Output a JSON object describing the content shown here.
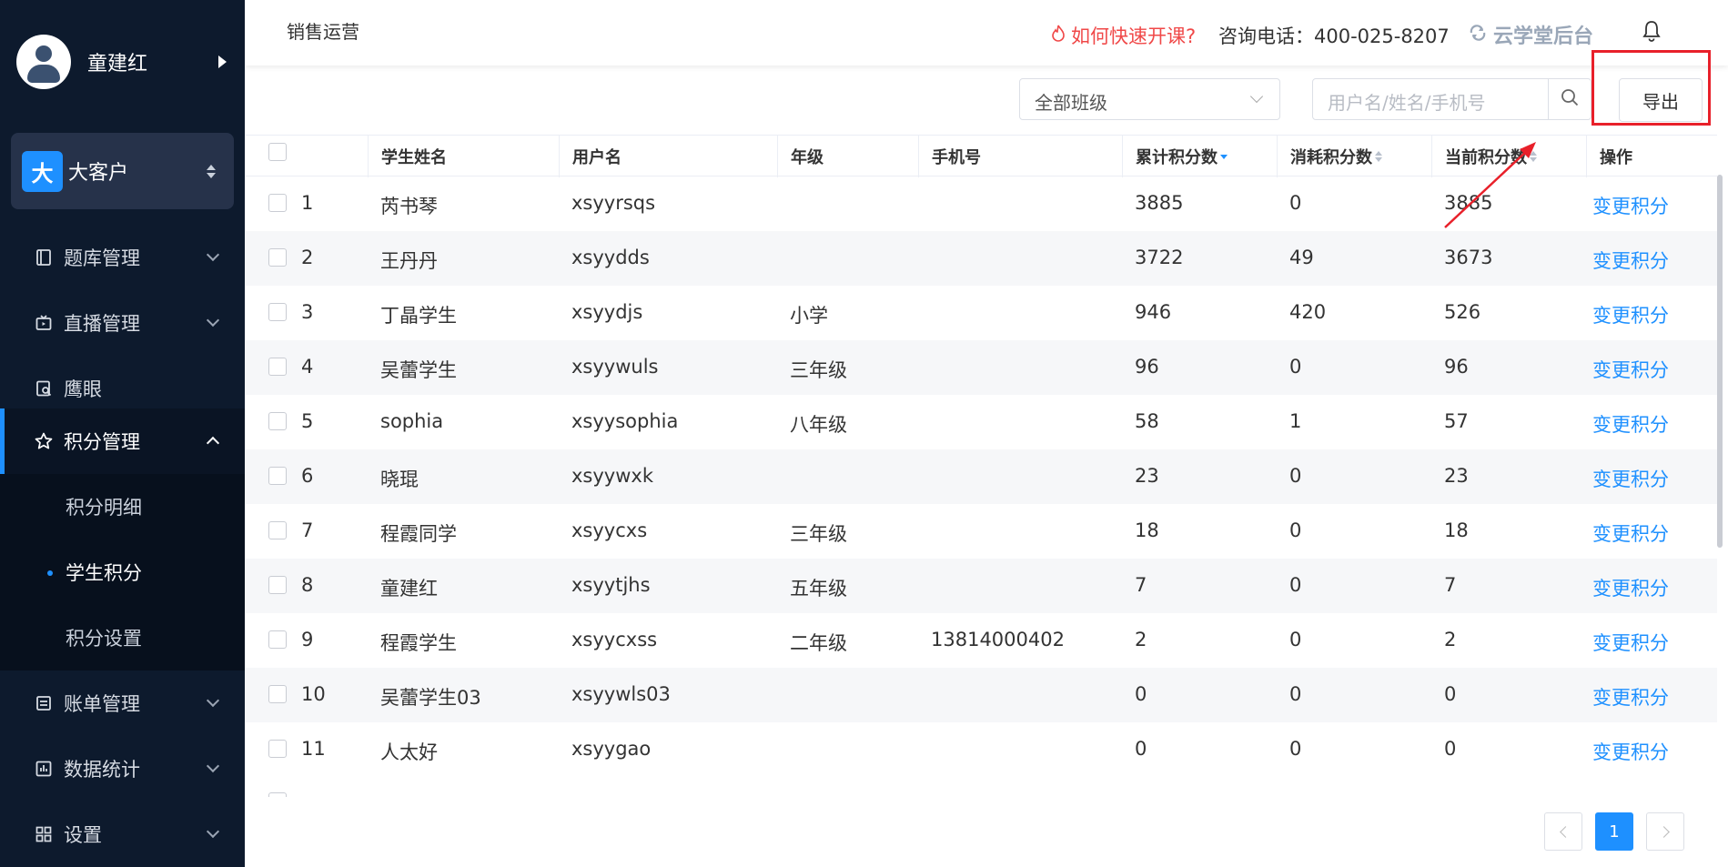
{
  "sidebar": {
    "user_name": "童建红",
    "org_badge": "大",
    "org_name": "大客户",
    "items": [
      {
        "label": "题库管理",
        "icon": "book-icon"
      },
      {
        "label": "直播管理",
        "icon": "live-icon"
      },
      {
        "label": "鹰眼",
        "icon": "eye-icon"
      },
      {
        "label": "积分管理",
        "icon": "star-icon"
      },
      {
        "label": "账单管理",
        "icon": "bill-icon"
      },
      {
        "label": "数据统计",
        "icon": "chart-icon"
      },
      {
        "label": "设置",
        "icon": "grid-icon"
      }
    ],
    "sub_items": [
      {
        "label": "积分明细"
      },
      {
        "label": "学生积分"
      },
      {
        "label": "积分设置"
      }
    ]
  },
  "header": {
    "title": "销售运营",
    "help_text": "如何快速开课?",
    "phone_text": "咨询电话：400-025-8207",
    "brand": "云学堂后台"
  },
  "toolbar": {
    "class_select": "全部班级",
    "search_placeholder": "用户名/姓名/手机号",
    "export_label": "导出"
  },
  "table": {
    "columns": [
      "学生姓名",
      "用户名",
      "年级",
      "手机号",
      "累计积分数",
      "消耗积分数",
      "当前积分数",
      "操作"
    ],
    "action_label": "变更积分",
    "rows": [
      {
        "no": "1",
        "name": "芮书琴",
        "user": "xsyyrsqs",
        "grade": "",
        "phone": "",
        "total": "3885",
        "used": "0",
        "current": "3885"
      },
      {
        "no": "2",
        "name": "王丹丹",
        "user": "xsyydds",
        "grade": "",
        "phone": "",
        "total": "3722",
        "used": "49",
        "current": "3673"
      },
      {
        "no": "3",
        "name": "丁晶学生",
        "user": "xsyydjs",
        "grade": "小学",
        "phone": "",
        "total": "946",
        "used": "420",
        "current": "526"
      },
      {
        "no": "4",
        "name": "吴蕾学生",
        "user": "xsyywuls",
        "grade": "三年级",
        "phone": "",
        "total": "96",
        "used": "0",
        "current": "96"
      },
      {
        "no": "5",
        "name": "sophia",
        "user": "xsyysophia",
        "grade": "八年级",
        "phone": "",
        "total": "58",
        "used": "1",
        "current": "57"
      },
      {
        "no": "6",
        "name": "晓琨",
        "user": "xsyywxk",
        "grade": "",
        "phone": "",
        "total": "23",
        "used": "0",
        "current": "23"
      },
      {
        "no": "7",
        "name": "程霞同学",
        "user": "xsyycxs",
        "grade": "三年级",
        "phone": "",
        "total": "18",
        "used": "0",
        "current": "18"
      },
      {
        "no": "8",
        "name": "童建红",
        "user": "xsyytjhs",
        "grade": "五年级",
        "phone": "",
        "total": "7",
        "used": "0",
        "current": "7"
      },
      {
        "no": "9",
        "name": "程霞学生",
        "user": "xsyycxss",
        "grade": "二年级",
        "phone": "13814000402",
        "total": "2",
        "used": "0",
        "current": "2"
      },
      {
        "no": "10",
        "name": "吴蕾学生03",
        "user": "xsyywls03",
        "grade": "",
        "phone": "",
        "total": "0",
        "used": "0",
        "current": "0"
      },
      {
        "no": "11",
        "name": "人太好",
        "user": "xsyygao",
        "grade": "",
        "phone": "",
        "total": "0",
        "used": "0",
        "current": "0"
      }
    ]
  },
  "pagination": {
    "current": "1"
  },
  "colors": {
    "accent": "#1e90ff",
    "sidebar_bg": "#0d1a2d",
    "highlight": "#e8202a",
    "help": "#f04848"
  }
}
